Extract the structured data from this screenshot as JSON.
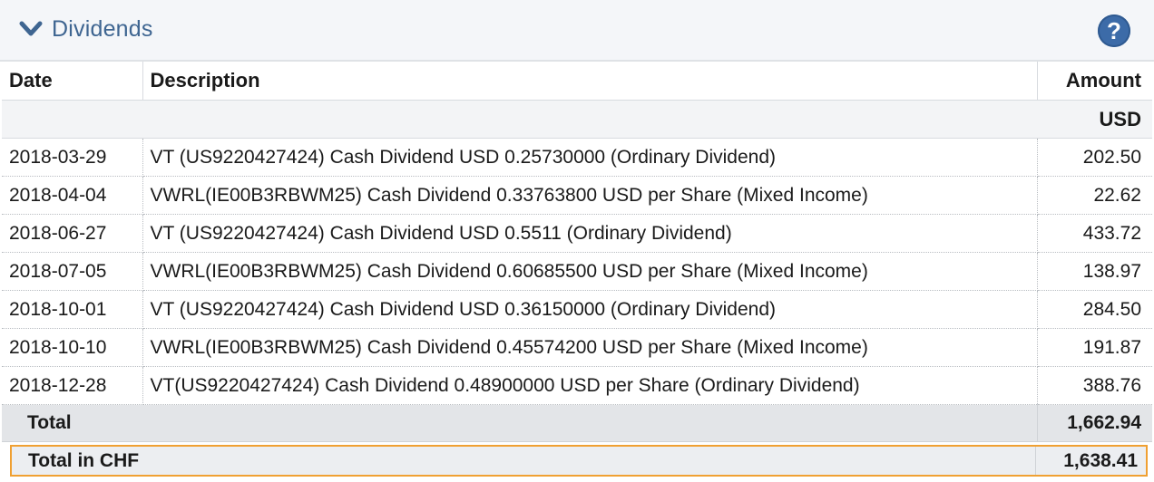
{
  "panel": {
    "title": "Dividends",
    "collapse_icon": "chevron-down-icon",
    "help_icon": "question-mark-icon",
    "help_label": "?",
    "accent_color": "#3e6591",
    "highlight_color": "#f0a032"
  },
  "table": {
    "headers": {
      "date": "Date",
      "description": "Description",
      "amount": "Amount"
    },
    "group": "USD",
    "rows": [
      {
        "date": "2018-03-29",
        "description": "VT (US9220427424) Cash Dividend USD 0.25730000 (Ordinary Dividend)",
        "amount": "202.50"
      },
      {
        "date": "2018-04-04",
        "description": "VWRL(IE00B3RBWM25) Cash Dividend 0.33763800 USD per Share (Mixed Income)",
        "amount": "22.62"
      },
      {
        "date": "2018-06-27",
        "description": "VT (US9220427424) Cash Dividend USD 0.5511 (Ordinary Dividend)",
        "amount": "433.72"
      },
      {
        "date": "2018-07-05",
        "description": "VWRL(IE00B3RBWM25) Cash Dividend 0.60685500 USD per Share (Mixed Income)",
        "amount": "138.97"
      },
      {
        "date": "2018-10-01",
        "description": "VT (US9220427424) Cash Dividend USD 0.36150000 (Ordinary Dividend)",
        "amount": "284.50"
      },
      {
        "date": "2018-10-10",
        "description": "VWRL(IE00B3RBWM25) Cash Dividend 0.45574200 USD per Share (Mixed Income)",
        "amount": "191.87"
      },
      {
        "date": "2018-12-28",
        "description": "VT(US9220427424) Cash Dividend 0.48900000 USD per Share (Ordinary Dividend)",
        "amount": "388.76"
      }
    ],
    "total": {
      "label": "Total",
      "amount": "1,662.94"
    },
    "total_chf": {
      "label": "Total in CHF",
      "amount": "1,638.41"
    }
  }
}
